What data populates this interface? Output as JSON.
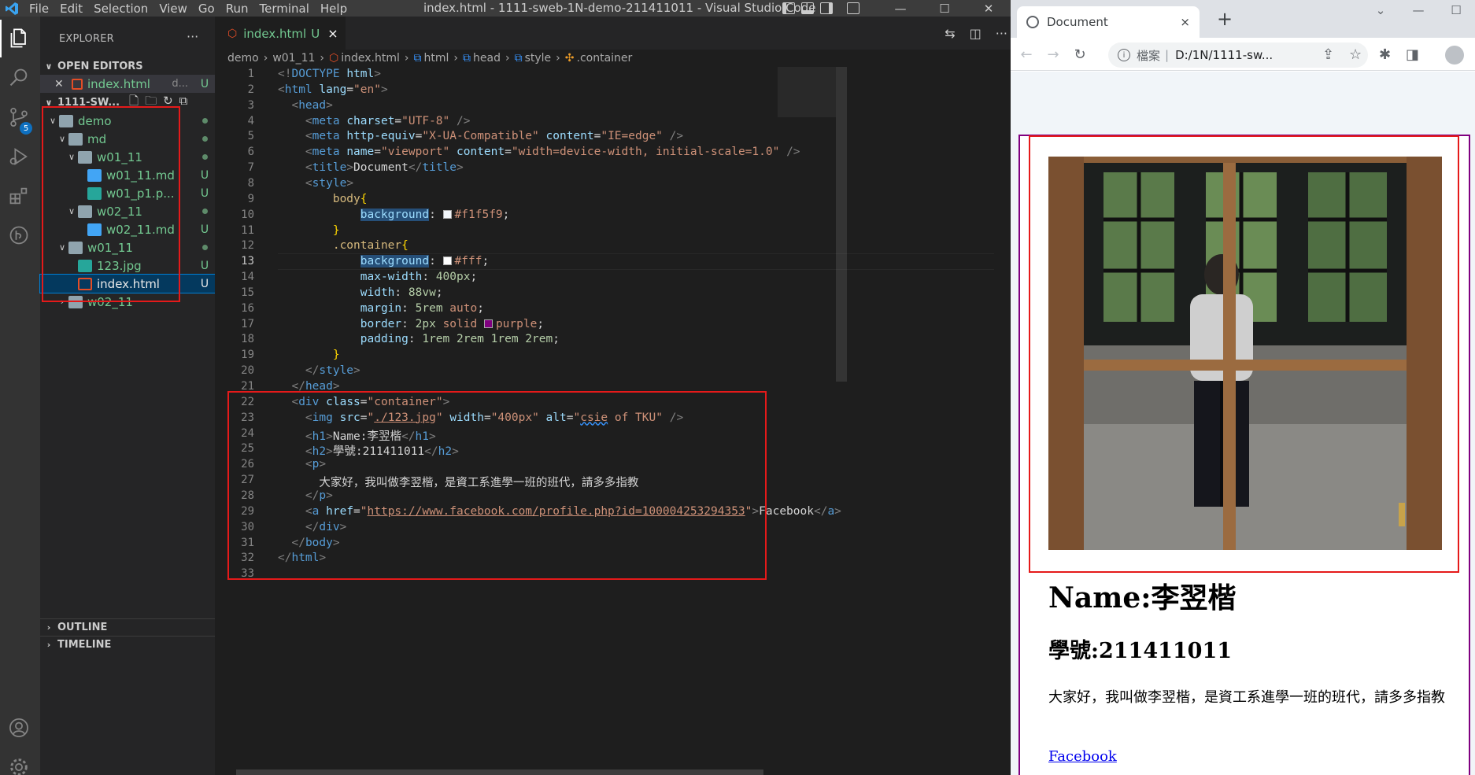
{
  "vscode": {
    "menu": [
      "File",
      "Edit",
      "Selection",
      "View",
      "Go",
      "Run",
      "Terminal",
      "Help"
    ],
    "window_title": "index.html - 1111-sweb-1N-demo-211411011 - Visual Studio Code",
    "scm_badge": "5",
    "explorer": {
      "header": "EXPLORER",
      "open_editors_label": "OPEN EDITORS",
      "open_editor_file": "index.html",
      "open_editor_suffix": "d...",
      "open_editor_status": "U",
      "workspace_label": "1111-SW...",
      "tree": [
        {
          "label": "demo",
          "kind": "folder",
          "status": "",
          "level": 1,
          "open": true
        },
        {
          "label": "md",
          "kind": "folder",
          "status": "",
          "level": 2,
          "open": true
        },
        {
          "label": "w01_11",
          "kind": "folder",
          "status": "",
          "level": 3,
          "open": true
        },
        {
          "label": "w01_11.md",
          "kind": "md",
          "status": "U",
          "level": 4
        },
        {
          "label": "w01_p1.p...",
          "kind": "img",
          "status": "U",
          "level": 4
        },
        {
          "label": "w02_11",
          "kind": "folder",
          "status": "",
          "level": 3,
          "open": true
        },
        {
          "label": "w02_11.md",
          "kind": "md",
          "status": "U",
          "level": 4
        },
        {
          "label": "w01_11",
          "kind": "folder",
          "status": "",
          "level": 2,
          "open": true
        },
        {
          "label": "123.jpg",
          "kind": "img",
          "status": "U",
          "level": 3
        },
        {
          "label": "index.html",
          "kind": "html",
          "status": "U",
          "level": 3,
          "selected": true
        },
        {
          "label": "w02_11",
          "kind": "folder",
          "status": "",
          "level": 2,
          "open": false
        }
      ],
      "outline_label": "OUTLINE",
      "timeline_label": "TIMELINE"
    },
    "tab": {
      "label": "index.html",
      "status": "U",
      "close": "×"
    },
    "breadcrumb": [
      "demo",
      "w01_11",
      "index.html",
      "html",
      "head",
      "style",
      ".container"
    ],
    "current_line": 13,
    "line_count": 33
  },
  "browser": {
    "tab_title": "Document",
    "tab_close": "×",
    "new_tab": "+",
    "address_scheme": "檔案",
    "address": "D:/1N/1111-sw...",
    "page": {
      "h1": "Name:李翌楷",
      "h2": "學號:211411011",
      "paragraph": "大家好，我叫做李翌楷，是資工系進學一班的班代，請多多指教",
      "link": "Facebook",
      "img_alt": "csie of TKU"
    },
    "colors": {
      "page_bg": "#f1f5f9",
      "container_bg": "#ffffff",
      "container_border": "purple"
    }
  }
}
